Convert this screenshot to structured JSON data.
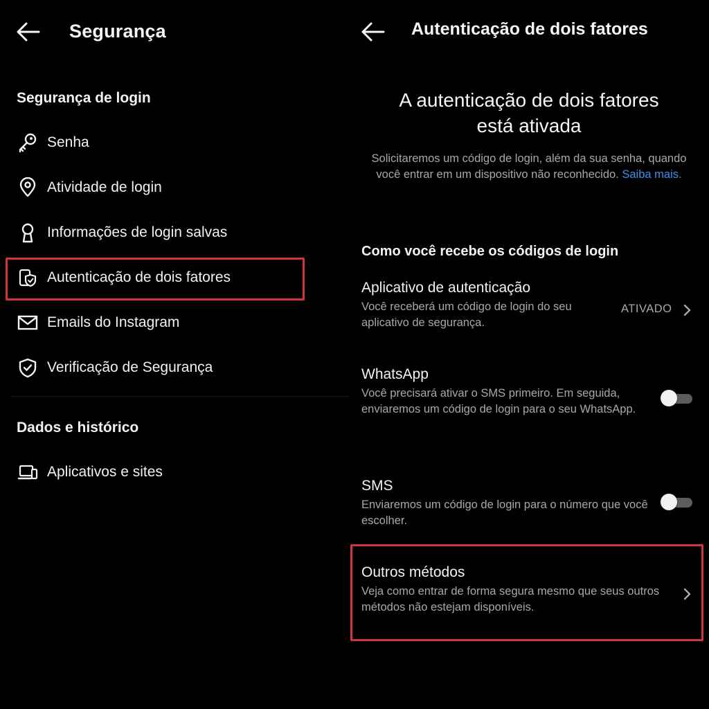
{
  "left": {
    "header": {
      "title": "Segurança"
    },
    "sections": [
      {
        "title": "Segurança de login",
        "items": [
          {
            "label": "Senha",
            "icon": "key-icon"
          },
          {
            "label": "Atividade de login",
            "icon": "location-pin-icon"
          },
          {
            "label": "Informações de login salvas",
            "icon": "keyhole-icon"
          },
          {
            "label": "Autenticação de dois fatores",
            "icon": "shield-phone-icon"
          },
          {
            "label": "Emails do Instagram",
            "icon": "envelope-icon"
          },
          {
            "label": "Verificação de Segurança",
            "icon": "shield-check-icon"
          }
        ]
      },
      {
        "title": "Dados e histórico",
        "items": [
          {
            "label": "Aplicativos e sites",
            "icon": "devices-icon"
          }
        ]
      }
    ]
  },
  "right": {
    "header": {
      "title": "Autenticação de dois fatores"
    },
    "status": {
      "heading_line1": "A autenticação de dois fatores",
      "heading_line2": "está ativada",
      "description": "Solicitaremos um código de login, além da sua senha, quando você entrar em um dispositivo não reconhecido.",
      "link": "Saiba mais."
    },
    "methods": {
      "title": "Como você recebe os códigos de login",
      "options": [
        {
          "title": "Aplicativo de autenticação",
          "description": "Você receberá um código de login do seu aplicativo de segurança.",
          "state": "ATIVADO"
        },
        {
          "title": "WhatsApp",
          "description": "Você precisará ativar o SMS primeiro. Em seguida, enviaremos um código de login para o seu WhatsApp.",
          "enabled": false
        },
        {
          "title": "SMS",
          "description": "Enviaremos um código de login para o número que você escolher.",
          "enabled": false
        },
        {
          "title": "Outros métodos",
          "description": "Veja como entrar de forma segura mesmo que seus outros métodos não estejam disponíveis."
        }
      ]
    }
  },
  "colors": {
    "background": "#000000",
    "text": "#f2f2f2",
    "secondary_text": "#a8a8a8",
    "link": "#3b92ea",
    "highlight": "#d0343c"
  }
}
